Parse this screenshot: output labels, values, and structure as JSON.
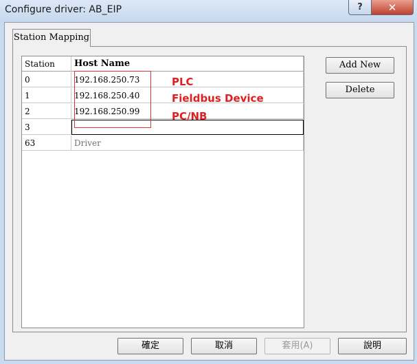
{
  "window": {
    "title": "Configure driver: AB_EIP",
    "help_label": "?",
    "close_label": "✕"
  },
  "tabs": [
    {
      "label": "Station Mapping"
    }
  ],
  "grid": {
    "columns": [
      "Station",
      "Host Name"
    ],
    "rows": [
      {
        "station": "0",
        "host": "192.168.250.73"
      },
      {
        "station": "1",
        "host": "192.168.250.40"
      },
      {
        "station": "2",
        "host": "192.168.250.99"
      },
      {
        "station": "3",
        "host": ""
      },
      {
        "station": "63",
        "host": "Driver"
      }
    ]
  },
  "annotations": {
    "plc": "PLC",
    "fieldbus": "Fieldbus Device",
    "pcnb": "PC/NB",
    "color": "#e02020"
  },
  "side_buttons": {
    "add_new": "Add New",
    "delete": "Delete"
  },
  "footer_buttons": {
    "ok": "確定",
    "cancel": "取消",
    "apply": "套用(A)",
    "help": "說明"
  }
}
